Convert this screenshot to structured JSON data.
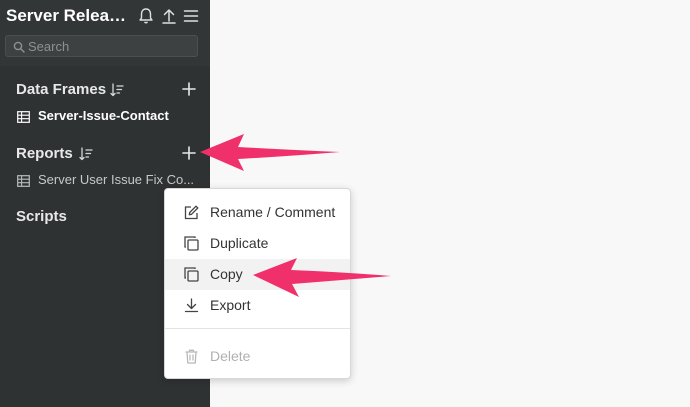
{
  "app": {
    "title": "Server Release..."
  },
  "toolbar": {
    "icons": [
      "bell-icon",
      "upload-icon",
      "menu-icon"
    ]
  },
  "search": {
    "placeholder": "Search"
  },
  "sections": {
    "data_frames": {
      "label": "Data Frames",
      "items": [
        {
          "label": "Server-Issue-Contact",
          "icon": "table-icon",
          "bold": true
        }
      ]
    },
    "reports": {
      "label": "Reports",
      "items": [
        {
          "label": "Server User Issue Fix Co...",
          "icon": "table-icon",
          "bold": false
        }
      ]
    },
    "scripts": {
      "label": "Scripts"
    }
  },
  "context_menu": {
    "items": [
      {
        "label": "Rename / Comment",
        "icon": "edit-icon",
        "enabled": true
      },
      {
        "label": "Duplicate",
        "icon": "duplicate-icon",
        "enabled": true
      },
      {
        "label": "Copy",
        "icon": "copy-icon",
        "enabled": true,
        "highlighted": true
      },
      {
        "label": "Export",
        "icon": "download-icon",
        "enabled": true
      },
      {
        "label": "Delete",
        "icon": "trash-icon",
        "enabled": false
      }
    ]
  },
  "colors": {
    "sidebar_bg": "#2f3233",
    "annotation_arrow": "#f0306a",
    "menu_bg": "#ffffff"
  }
}
